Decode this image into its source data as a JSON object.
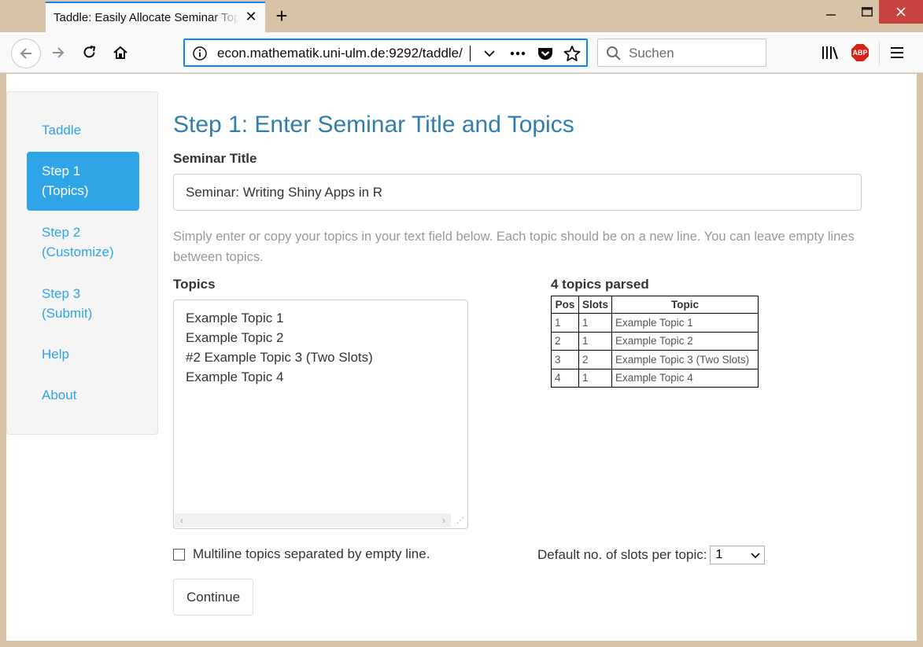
{
  "browser": {
    "tab_title": "Taddle: Easily Allocate Seminar Topics",
    "tab_close_glyph": "✕",
    "new_tab_glyph": "+",
    "url": "econ.mathematik.uni-ulm.de:9292/taddle/",
    "search_placeholder": "Suchen",
    "abp_label": "ABP",
    "accent_color": "#0a84ff"
  },
  "sidebar": {
    "items": [
      {
        "label": "Taddle",
        "active": false
      },
      {
        "label_line1": "Step 1",
        "label_line2": "(Topics)",
        "active": true
      },
      {
        "label_line1": "Step 2",
        "label_line2": "(Customize)",
        "active": false
      },
      {
        "label_line1": "Step 3",
        "label_line2": "(Submit)",
        "active": false
      },
      {
        "label": "Help",
        "active": false
      },
      {
        "label": "About",
        "active": false
      }
    ],
    "link_color": "#2fa4e7"
  },
  "main": {
    "heading": "Step 1: Enter Seminar Title and Topics",
    "seminar_title_label": "Seminar Title",
    "seminar_title_value": "Seminar: Writing Shiny Apps in R",
    "help_text": "Simply enter or copy your topics in your text field below. Each topic should be on a new line. You can leave empty lines between topics.",
    "topics_label": "Topics",
    "topics_lines": [
      "Example Topic 1",
      "Example Topic 2",
      "#2 Example Topic 3 (Two Slots)",
      "Example Topic 4"
    ],
    "parsed_heading": "4 topics parsed",
    "parsed_table": {
      "headers": [
        "Pos",
        "Slots",
        "Topic"
      ],
      "rows": [
        [
          "1",
          "1",
          "Example Topic 1"
        ],
        [
          "2",
          "1",
          "Example Topic 2"
        ],
        [
          "3",
          "2",
          "Example Topic 3 (Two Slots)"
        ],
        [
          "4",
          "1",
          "Example Topic 4"
        ]
      ]
    },
    "multiline_checkbox_label": "Multiline topics separated by empty line.",
    "multiline_checked": false,
    "default_slots_label": "Default no. of slots per topic:",
    "default_slots_value": "1",
    "continue_label": "Continue",
    "heading_color": "#317eac"
  }
}
